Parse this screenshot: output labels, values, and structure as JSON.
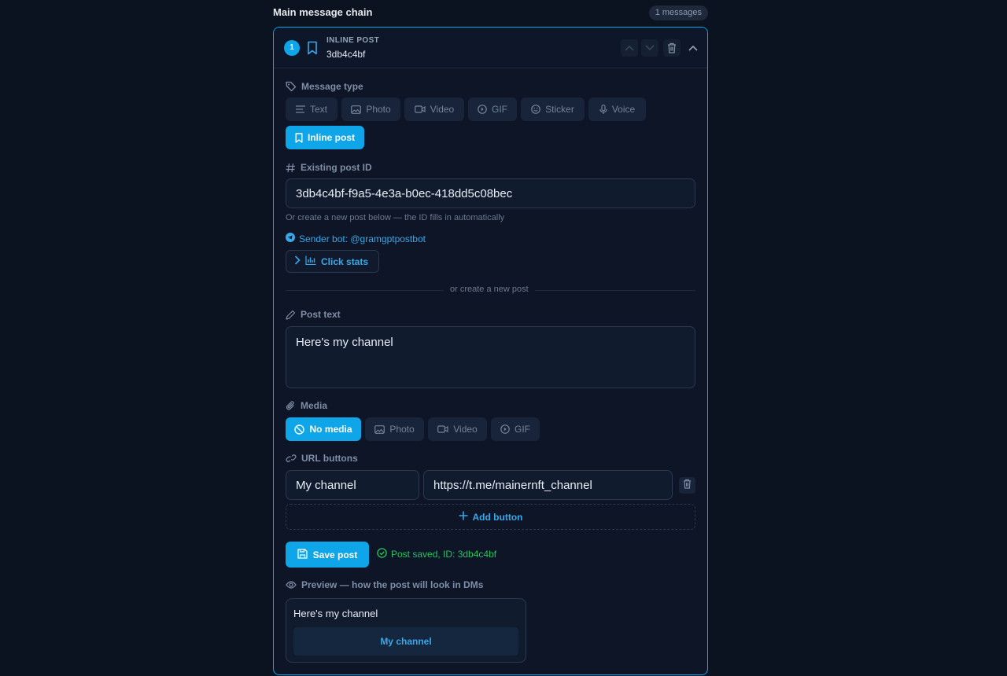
{
  "section": {
    "title": "Main message chain",
    "count": "1 messages"
  },
  "message": {
    "number": "1",
    "kind": "INLINE POST",
    "short_id": "3db4c4bf",
    "icons": {
      "bookmark": "bookmark-icon",
      "move_up": "chevron-up-icon",
      "move_down": "chevron-down-icon",
      "delete": "trash-icon",
      "collapse": "chevron-up-icon"
    },
    "accent_color": "#0ea5e9"
  },
  "message_type": {
    "label": "Message type",
    "options": [
      {
        "label": "Text",
        "icon": "text-lines-icon"
      },
      {
        "label": "Photo",
        "icon": "image-icon"
      },
      {
        "label": "Video",
        "icon": "video-camera-icon"
      },
      {
        "label": "GIF",
        "icon": "play-circle-icon"
      },
      {
        "label": "Sticker",
        "icon": "smiley-icon"
      },
      {
        "label": "Voice",
        "icon": "microphone-icon"
      },
      {
        "label": "Inline post",
        "icon": "bookmark-icon"
      }
    ],
    "selected": "Inline post"
  },
  "existing_post": {
    "label": "Existing post ID",
    "value": "3db4c4bf-f9a5-4e3a-b0ec-418dd5c08bec",
    "hint": "Or create a new post below — the ID fills in automatically",
    "sender": "Sender bot: @gramgptpostbot",
    "stats_button": "Click stats"
  },
  "divider_text": "or create a new post",
  "post_text": {
    "label": "Post text",
    "value": "Here's my channel"
  },
  "media": {
    "label": "Media",
    "options": [
      {
        "label": "No media",
        "icon": "ban-icon"
      },
      {
        "label": "Photo",
        "icon": "image-icon"
      },
      {
        "label": "Video",
        "icon": "video-camera-icon"
      },
      {
        "label": "GIF",
        "icon": "play-circle-icon"
      }
    ],
    "selected": "No media"
  },
  "url_buttons": {
    "label": "URL buttons",
    "rows": [
      {
        "title": "My channel",
        "url": "https://t.me/mainernft_channel"
      }
    ],
    "add_label": "Add button"
  },
  "save": {
    "label": "Save post",
    "status": "Post saved, ID: 3db4c4bf",
    "status_color": "#22c55e"
  },
  "preview": {
    "label": "Preview — how the post will look in DMs",
    "text": "Here's my channel",
    "button": "My channel"
  }
}
